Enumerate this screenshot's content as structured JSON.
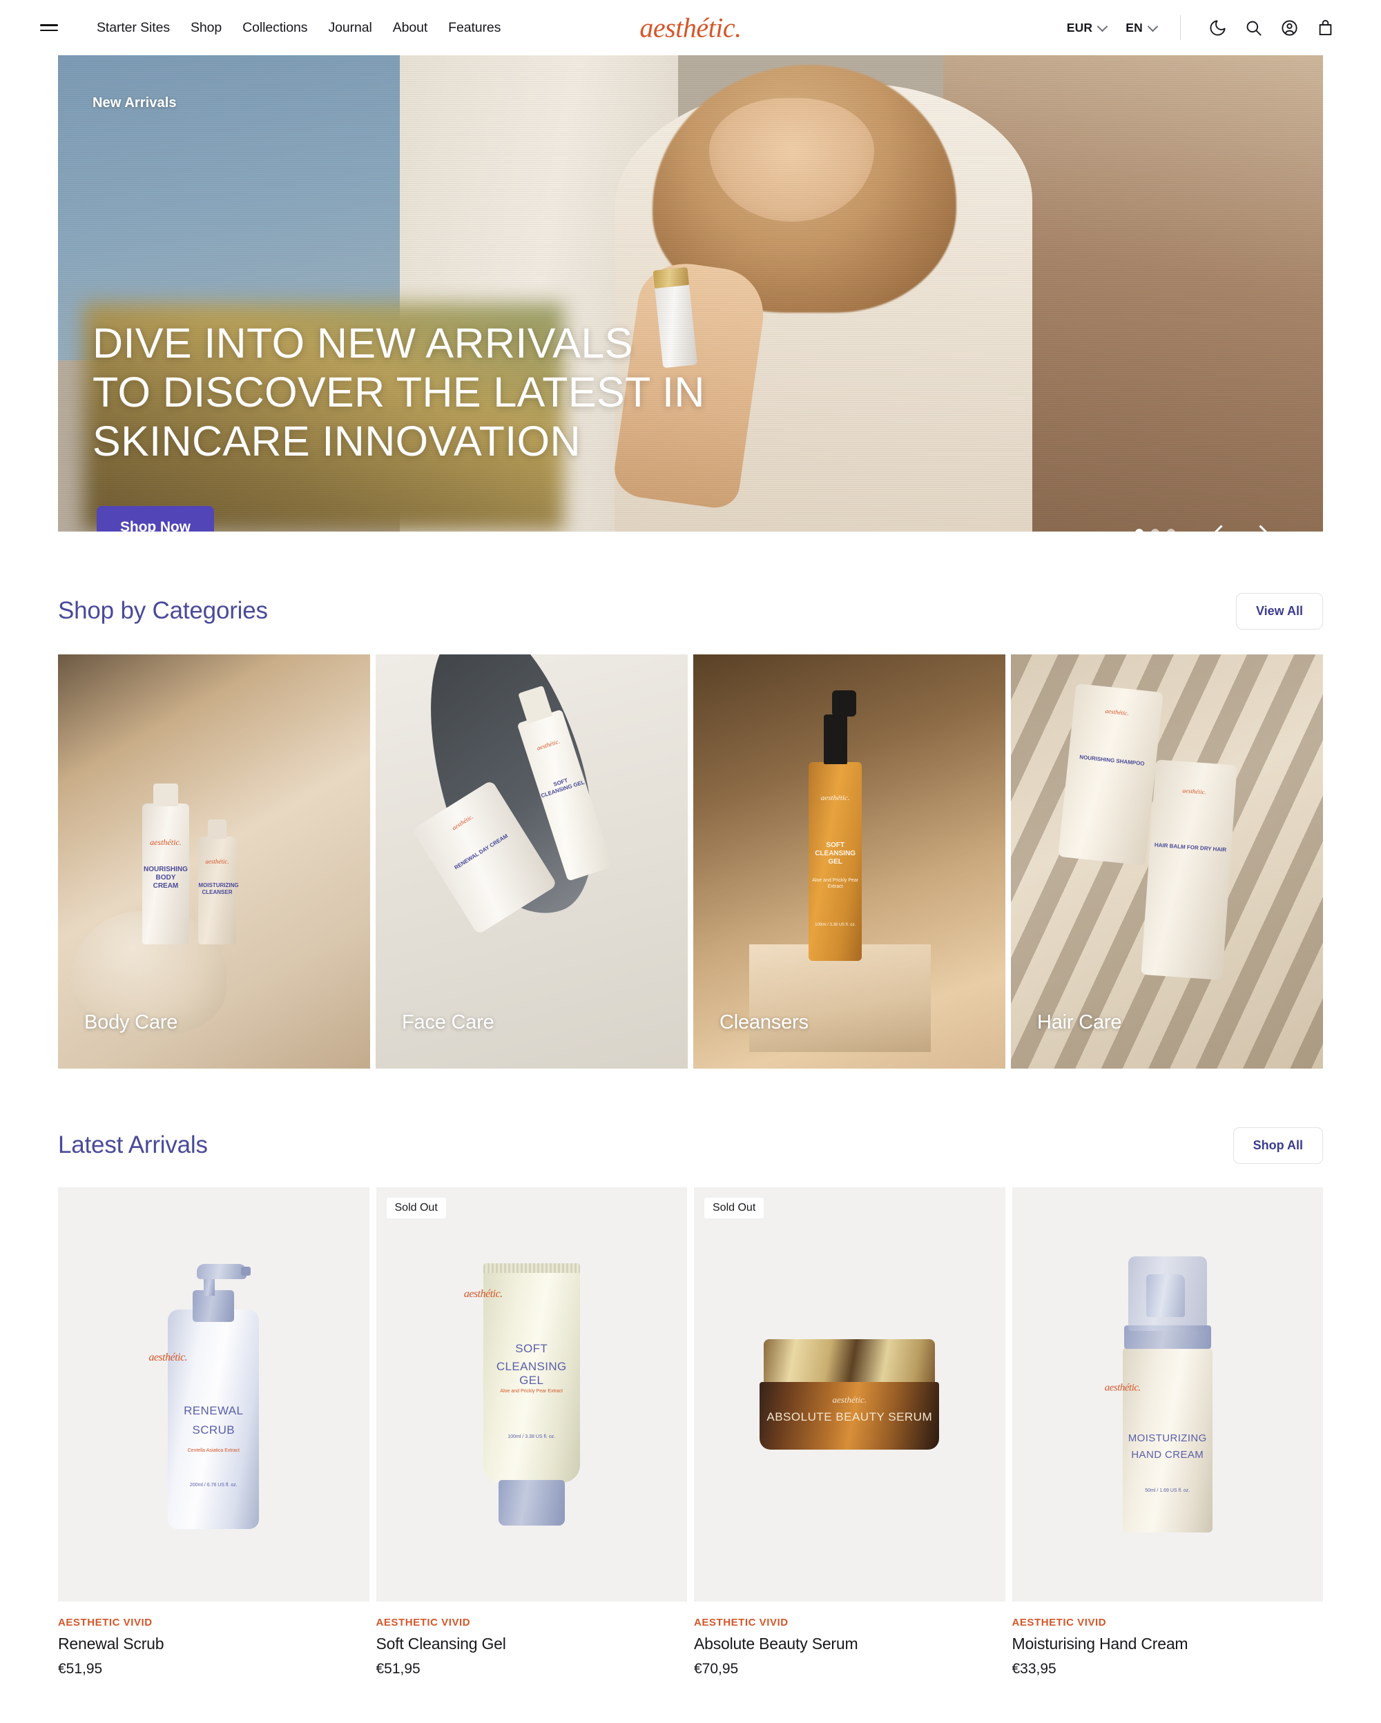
{
  "header": {
    "menu_icon": "hamburger-icon",
    "nav": [
      {
        "label": "Starter Sites"
      },
      {
        "label": "Shop"
      },
      {
        "label": "Collections"
      },
      {
        "label": "Journal"
      },
      {
        "label": "About"
      },
      {
        "label": "Features"
      }
    ],
    "logo": "aesthétic.",
    "currency": "EUR",
    "language": "EN",
    "icons": [
      "moon-icon",
      "search-icon",
      "account-icon",
      "bag-icon"
    ]
  },
  "hero": {
    "eyebrow": "New Arrivals",
    "title": "DIVE INTO NEW ARRIVALS\nTO DISCOVER THE LATEST IN\nSKINCARE INNOVATION",
    "cta": "Shop Now",
    "cta_color": "#5145b8",
    "slides": 3,
    "active_slide": 1,
    "prev_icon": "chevron-left-icon",
    "next_icon": "chevron-right-icon"
  },
  "categories_section": {
    "title": "Shop by Categories",
    "action": "View All",
    "accent_color": "#4a4a99",
    "items": [
      {
        "label": "Body Care"
      },
      {
        "label": "Face Care"
      },
      {
        "label": "Cleansers"
      },
      {
        "label": "Hair Care"
      }
    ]
  },
  "category_art": {
    "body": {
      "logo": "aesthétic.",
      "name1": "NOURISHING BODY CREAM",
      "name2": "MOISTURIZING CLEANSER"
    },
    "face": {
      "logo": "aesthétic.",
      "name1": "RENEWAL DAY CREAM",
      "name2": "SOFT CLEANSING GEL"
    },
    "cleansers": {
      "logo": "aesthétic.",
      "name": "SOFT CLEANSING GEL",
      "extract": "Aloe and Prickly Pear Extract",
      "volume": "100ml / 3.38 US fl. oz."
    },
    "hair": {
      "logo": "aesthétic.",
      "name1": "NOURISHING SHAMPOO",
      "name2": "HAIR BALM FOR DRY HAIR"
    }
  },
  "products_section": {
    "title": "Latest Arrivals",
    "action": "Shop All",
    "accent_color": "#4a4a99",
    "vendor_color": "#d4572a",
    "items": [
      {
        "vendor": "AESTHETIC VIVID",
        "title": "Renewal Scrub",
        "price": "€51,95",
        "badge": null,
        "art": {
          "logo": "aesthétic.",
          "name1": "RENEWAL",
          "name2": "SCRUB",
          "extract": "Centella Asiatica Extract",
          "volume": "200ml / 6.76 US fl. oz."
        }
      },
      {
        "vendor": "AESTHETIC VIVID",
        "title": "Soft Cleansing Gel",
        "price": "€51,95",
        "badge": "Sold Out",
        "art": {
          "logo": "aesthétic.",
          "name1": "SOFT",
          "name2": "CLEANSING GEL",
          "extract": "Aloe and Prickly Pear Extract",
          "volume": "100ml / 3.38 US fl. oz."
        }
      },
      {
        "vendor": "AESTHETIC VIVID",
        "title": "Absolute Beauty Serum",
        "price": "€70,95",
        "badge": "Sold Out",
        "art": {
          "logo": "aesthétic.",
          "name1": "ABSOLUTE BEAUTY SERUM",
          "name2": "",
          "extract": "",
          "volume": ""
        }
      },
      {
        "vendor": "AESTHETIC VIVID",
        "title": "Moisturising Hand Cream",
        "price": "€33,95",
        "badge": null,
        "art": {
          "logo": "aesthétic.",
          "name1": "MOISTURIZING",
          "name2": "HAND CREAM",
          "extract": "",
          "volume": "50ml / 1.69 US fl. oz."
        }
      }
    ]
  }
}
